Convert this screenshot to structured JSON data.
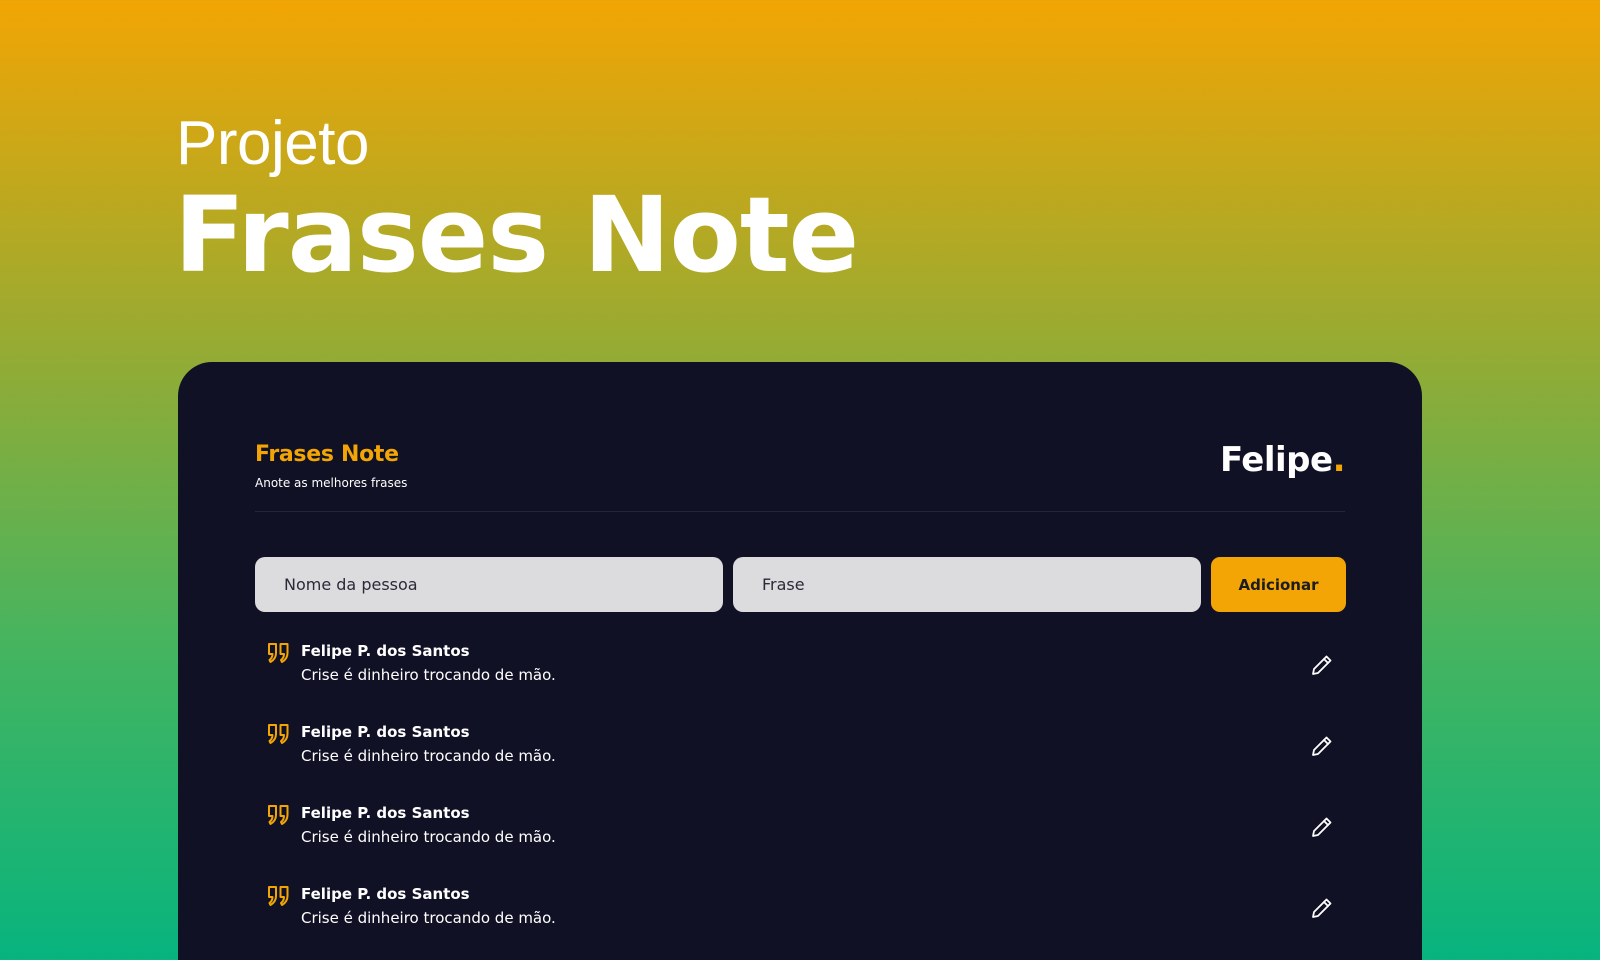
{
  "hero": {
    "subtitle": "Projeto",
    "title": "Frases Note"
  },
  "app": {
    "brand_title": "Frases Note",
    "brand_tagline": "Anote as melhores frases",
    "author_name": "Felipe",
    "author_dot": "."
  },
  "form": {
    "name_placeholder": "Nome da pessoa",
    "phrase_placeholder": "Frase",
    "add_label": "Adicionar"
  },
  "quotes": [
    {
      "author": "Felipe P. dos Santos",
      "text": "Crise é dinheiro trocando de mão."
    },
    {
      "author": "Felipe P. dos Santos",
      "text": "Crise é dinheiro trocando de mão."
    },
    {
      "author": "Felipe P. dos Santos",
      "text": "Crise é dinheiro trocando de mão."
    },
    {
      "author": "Felipe P. dos Santos",
      "text": "Crise é dinheiro trocando de mão."
    }
  ],
  "icons": {
    "quote": "quote-icon",
    "edit": "pencil-icon"
  },
  "colors": {
    "accent": "#f2a504",
    "card_bg": "#111126",
    "gradient_top": "#f2a504",
    "gradient_bottom": "#07b47e"
  }
}
